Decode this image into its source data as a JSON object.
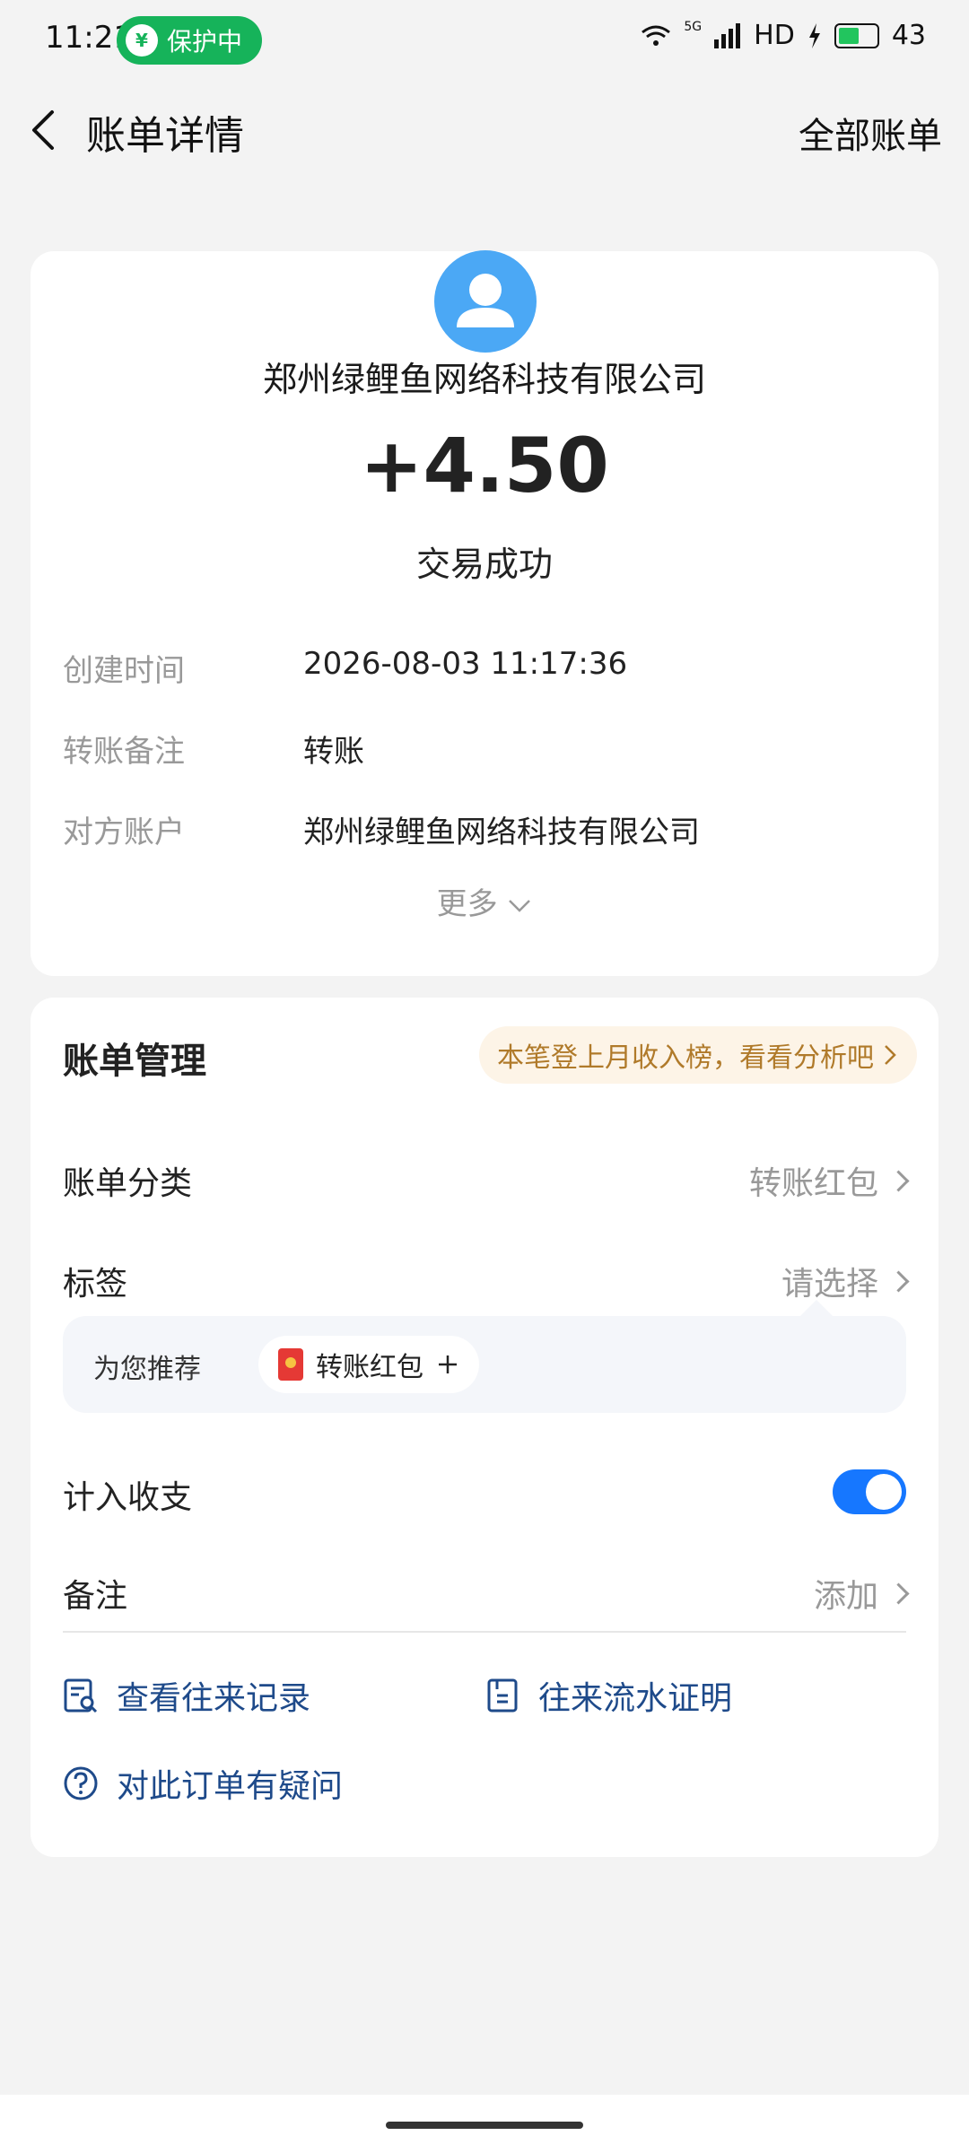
{
  "status_bar": {
    "time": "11:21",
    "protect_label": "保护中",
    "network": "5G",
    "hd": "HD",
    "battery": "43"
  },
  "nav": {
    "title": "账单详情",
    "right_action": "全部账单"
  },
  "summary": {
    "merchant_name": "郑州绿鲤鱼网络科技有限公司",
    "amount": "+4.50",
    "status": "交易成功",
    "details": [
      {
        "label": "创建时间",
        "value": "2026-08-03 11:17:36"
      },
      {
        "label": "转账备注",
        "value": "转账"
      },
      {
        "label": "对方账户",
        "value": "郑州绿鲤鱼网络科技有限公司"
      }
    ],
    "more": "更多"
  },
  "management": {
    "title": "账单管理",
    "promo": "本笔登上月收入榜，看看分析吧",
    "category_label": "账单分类",
    "category_value": "转账红包",
    "tag_label": "标签",
    "tag_value": "请选择",
    "recommend_label": "为您推荐",
    "recommend_chip": "转账红包",
    "include_label": "计入收支",
    "include_enabled": true,
    "note_label": "备注",
    "note_value": "添加",
    "links": {
      "history": "查看往来记录",
      "proof": "往来流水证明",
      "question": "对此订单有疑问"
    }
  },
  "colors": {
    "accent": "#1677ff",
    "link": "#1e4a8a",
    "protect_green": "#16b35a",
    "avatar_blue": "#4ba8f5",
    "promo_text": "#b07a2a"
  }
}
